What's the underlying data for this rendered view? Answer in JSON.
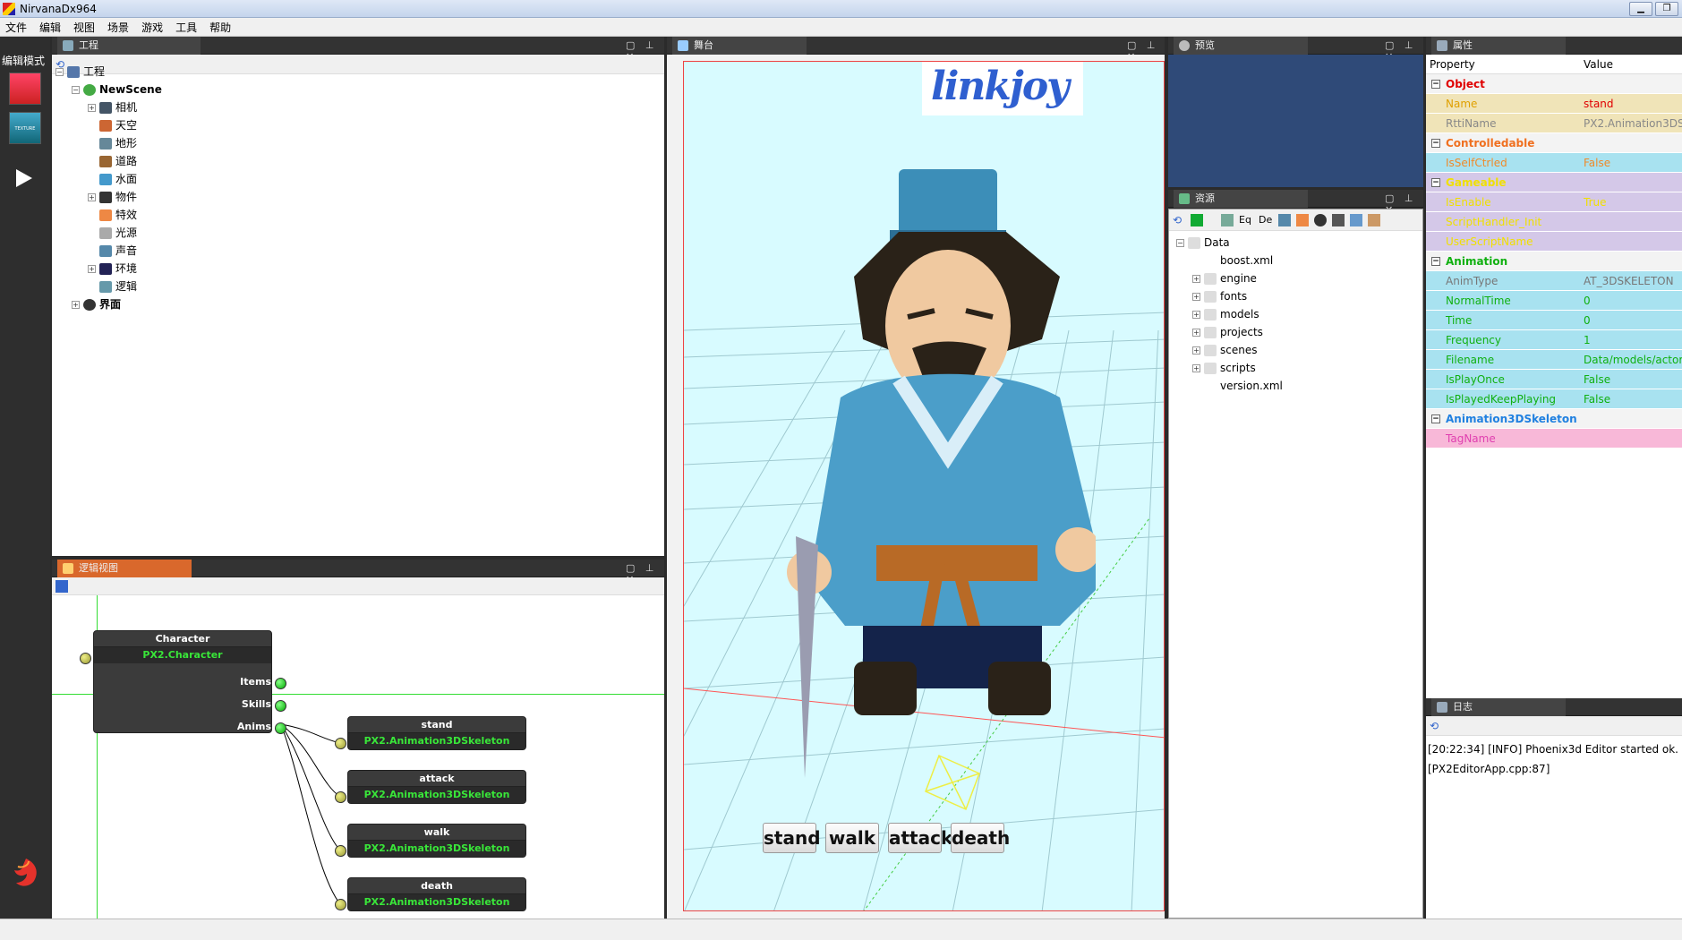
{
  "window": {
    "title": "NirvanaDx964",
    "minimize": "▁",
    "maximize": "❐"
  },
  "menu": [
    "文件",
    "编辑",
    "视图",
    "场景",
    "游戏",
    "工具",
    "帮助"
  ],
  "modebar": {
    "label": "编辑模式",
    "edit_btn_text": "TEXTURE"
  },
  "panels": {
    "project": "工程",
    "logic": "逻辑视图",
    "stage": "舞台",
    "preview": "预览",
    "resource": "资源",
    "property": "属性",
    "log": "日志"
  },
  "project_tree": {
    "root": "工程",
    "scene": "NewScene",
    "children": [
      "相机",
      "天空",
      "地形",
      "道路",
      "水面",
      "物件",
      "特效",
      "光源",
      "声音",
      "环境",
      "逻辑"
    ],
    "ui": "界面"
  },
  "logic": {
    "character": {
      "title": "Character",
      "class": "PX2.Character",
      "slots": [
        "Items",
        "Skills",
        "Anims"
      ]
    },
    "anims": [
      {
        "title": "stand",
        "class": "PX2.Animation3DSkeleton"
      },
      {
        "title": "attack",
        "class": "PX2.Animation3DSkeleton"
      },
      {
        "title": "walk",
        "class": "PX2.Animation3DSkeleton"
      },
      {
        "title": "death",
        "class": "PX2.Animation3DSkeleton"
      }
    ]
  },
  "stage": {
    "logo": "linkjoy",
    "buttons": [
      "stand",
      "walk",
      "attack",
      "death"
    ]
  },
  "resources": {
    "toolbar": [
      "Eq",
      "De"
    ],
    "root": "Data",
    "items": [
      {
        "name": "boost.xml",
        "folder": false
      },
      {
        "name": "engine",
        "folder": true
      },
      {
        "name": "fonts",
        "folder": true
      },
      {
        "name": "models",
        "folder": true
      },
      {
        "name": "projects",
        "folder": true
      },
      {
        "name": "scenes",
        "folder": true
      },
      {
        "name": "scripts",
        "folder": true
      },
      {
        "name": "version.xml",
        "folder": false
      }
    ]
  },
  "properties": {
    "header": {
      "property": "Property",
      "value": "Value"
    },
    "rows": [
      {
        "type": "section",
        "label": "Object",
        "color": "#e00000",
        "bg": "#f3f3f3"
      },
      {
        "type": "row",
        "label": "Name",
        "value": "stand",
        "kcolor": "#e0a000",
        "vcolor": "#e00000",
        "bg": "#f0e4b8"
      },
      {
        "type": "row",
        "label": "RttiName",
        "value": "PX2.Animation3DS",
        "kcolor": "#888888",
        "vcolor": "#888888",
        "bg": "#f0e4b8"
      },
      {
        "type": "section",
        "label": "Controlledable",
        "color": "#f07020",
        "bg": "#f3f3f3"
      },
      {
        "type": "row",
        "label": "IsSelfCtrled",
        "value": "False",
        "kcolor": "#ef8a2a",
        "vcolor": "#ef8a2a",
        "bg": "#a8e2f0"
      },
      {
        "type": "section",
        "label": "Gameable",
        "color": "#f0e000",
        "bg": "#d4c8e8"
      },
      {
        "type": "row",
        "label": "IsEnable",
        "value": "True",
        "kcolor": "#f0e000",
        "vcolor": "#f0e000",
        "bg": "#d4c8e8"
      },
      {
        "type": "row",
        "label": "ScriptHandler_Init",
        "value": "",
        "kcolor": "#f0e000",
        "vcolor": "#f0e000",
        "bg": "#d4c8e8"
      },
      {
        "type": "row",
        "label": "UserScriptName",
        "value": "",
        "kcolor": "#f0e000",
        "vcolor": "#f0e000",
        "bg": "#d4c8e8"
      },
      {
        "type": "section",
        "label": "Animation",
        "color": "#10b010",
        "bg": "#f3f3f3"
      },
      {
        "type": "row",
        "label": "AnimType",
        "value": "AT_3DSKELETON",
        "kcolor": "#777777",
        "vcolor": "#777777",
        "bg": "#a8e2f0"
      },
      {
        "type": "row",
        "label": "NormalTime",
        "value": "0",
        "kcolor": "#10b010",
        "vcolor": "#10b010",
        "bg": "#a8e2f0"
      },
      {
        "type": "row",
        "label": "Time",
        "value": "0",
        "kcolor": "#10b010",
        "vcolor": "#10b010",
        "bg": "#a8e2f0"
      },
      {
        "type": "row",
        "label": "Frequency",
        "value": "1",
        "kcolor": "#10b010",
        "vcolor": "#10b010",
        "bg": "#a8e2f0"
      },
      {
        "type": "row",
        "label": "Filename",
        "value": "Data/models/actor",
        "kcolor": "#10b010",
        "vcolor": "#10b010",
        "bg": "#a8e2f0"
      },
      {
        "type": "row",
        "label": "IsPlayOnce",
        "value": "False",
        "kcolor": "#10b010",
        "vcolor": "#10b010",
        "bg": "#a8e2f0"
      },
      {
        "type": "row",
        "label": "IsPlayedKeepPlaying",
        "value": "False",
        "kcolor": "#10b010",
        "vcolor": "#10b010",
        "bg": "#a8e2f0"
      },
      {
        "type": "section",
        "label": "Animation3DSkeleton",
        "color": "#2080e0",
        "bg": "#f3f3f3"
      },
      {
        "type": "row",
        "label": "TagName",
        "value": "",
        "kcolor": "#e040b0",
        "vcolor": "#e040b0",
        "bg": "#f8b8d8"
      }
    ]
  },
  "log": {
    "lines": [
      "[20:22:34] [INFO] Phoenix3d Editor started ok.",
      "[PX2EditorApp.cpp:87]"
    ]
  }
}
